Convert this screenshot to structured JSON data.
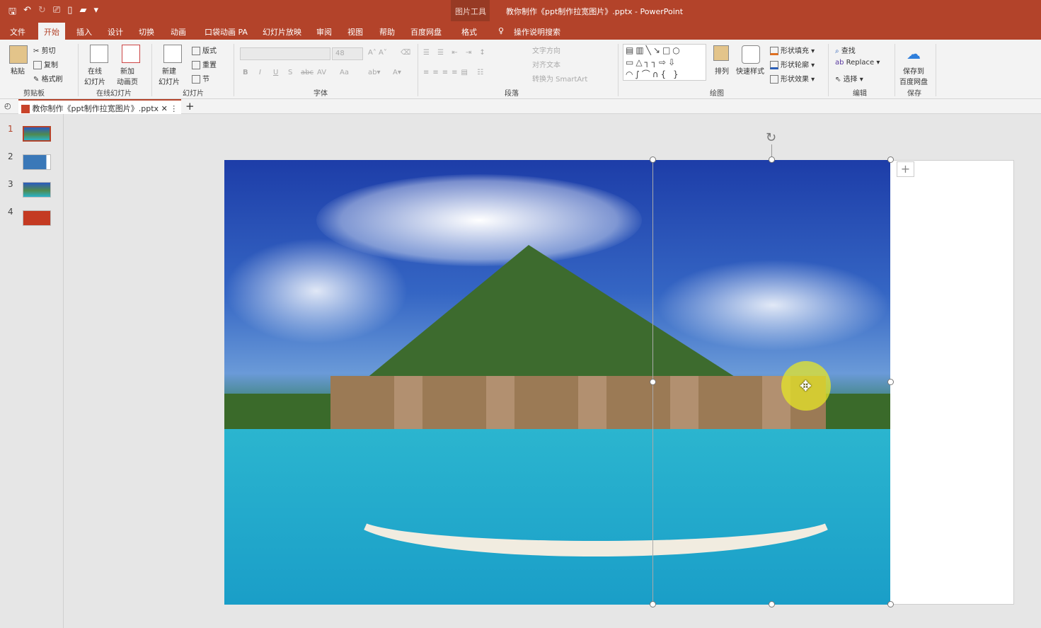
{
  "title_bar": {
    "context_tool": "图片工具",
    "window_title": "教你制作《ppt制作拉宽图片》.pptx  -  PowerPoint"
  },
  "tabs": [
    "文件",
    "开始",
    "插入",
    "设计",
    "切换",
    "动画",
    "口袋动画 PA",
    "幻灯片放映",
    "审阅",
    "视图",
    "帮助",
    "百度网盘",
    "格式"
  ],
  "tell_me": "操作说明搜索",
  "ribbon": {
    "clipboard": {
      "paste": "粘贴",
      "cut": "剪切",
      "copy": "复制",
      "format_painter": "格式刷",
      "label": "剪贴板"
    },
    "online": {
      "online_slides": "在线\n幻灯片",
      "new_anim": "新加\n动画页",
      "label": "在线幻灯片"
    },
    "slides": {
      "new_slide": "新建\n幻灯片",
      "layout": "版式",
      "reset": "重置",
      "section": "节",
      "label": "幻灯片"
    },
    "font": {
      "size": "48",
      "label": "字体",
      "bold": "B",
      "italic": "I",
      "underline": "U",
      "shadow": "S",
      "strike": "abc",
      "spacing": "AV",
      "case": "Aa"
    },
    "paragraph": {
      "text_direction": "文字方向",
      "align_text": "对齐文本",
      "smartart": "转换为 SmartArt",
      "label": "段落"
    },
    "drawing": {
      "arrange": "排列",
      "quick_styles": "快速样式",
      "fill": "形状填充",
      "outline": "形状轮廓",
      "effects": "形状效果",
      "label": "绘图"
    },
    "editing": {
      "find": "查找",
      "replace": "Replace",
      "select": "选择",
      "label": "编辑"
    },
    "save": {
      "save_baidu": "保存到\n百度网盘",
      "label": "保存"
    }
  },
  "doc_tab": "教你制作《ppt制作拉宽图片》.pptx",
  "slides": [
    {
      "n": "1"
    },
    {
      "n": "2"
    },
    {
      "n": "3"
    },
    {
      "n": "4"
    }
  ]
}
